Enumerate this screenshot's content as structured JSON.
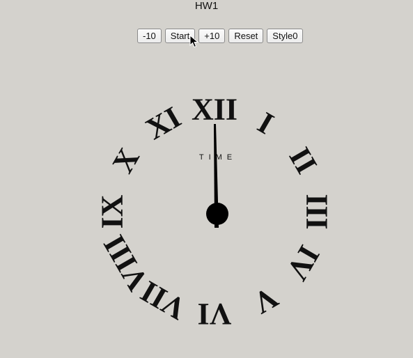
{
  "page": {
    "title": "HW1"
  },
  "toolbar": {
    "minus10_label": "-10",
    "start_label": "Start",
    "plus10_label": "+10",
    "reset_label": "Reset",
    "style_label": "Style0"
  },
  "clock": {
    "face_label": "TIME",
    "numerals": [
      "XII",
      "I",
      "II",
      "III",
      "IV",
      "V",
      "VI",
      "VII",
      "VIII",
      "IX",
      "X",
      "XI"
    ],
    "hand_color": "#000000",
    "numeral_color": "#111111"
  },
  "cursor": {
    "icon": "mouse-pointer-icon"
  }
}
